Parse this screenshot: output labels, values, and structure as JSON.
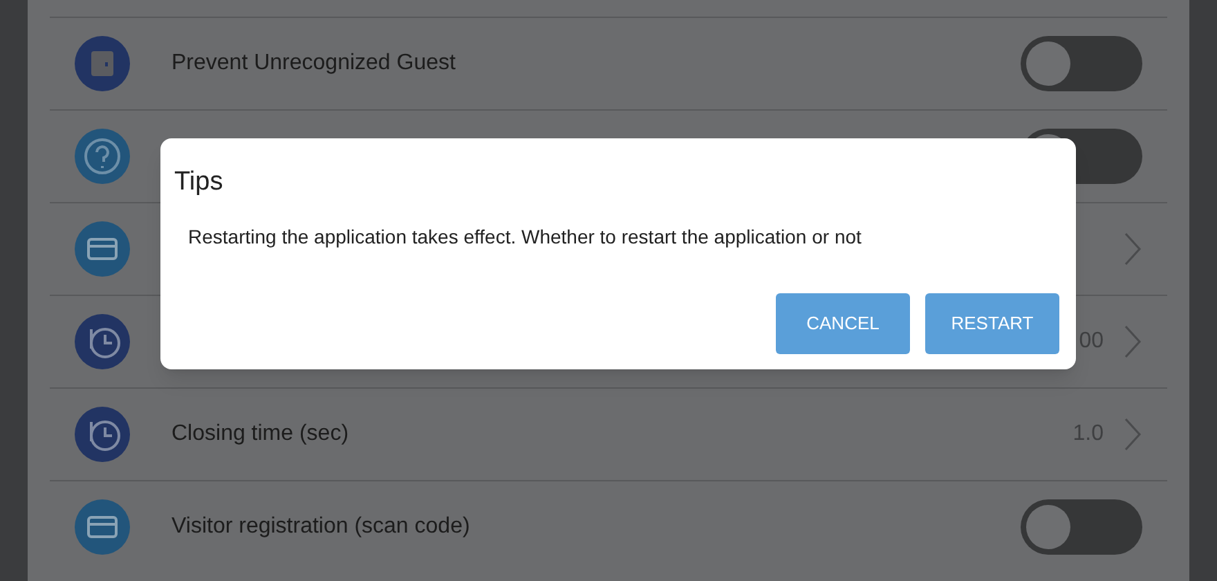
{
  "settings": [
    {
      "kind": "toggle",
      "label": "Prevent Unrecognized Guest",
      "on": false
    },
    {
      "kind": "toggle",
      "on": false
    },
    {
      "kind": "link"
    },
    {
      "kind": "link",
      "value": "00"
    },
    {
      "kind": "link",
      "label": "Closing time (sec)",
      "value": "1.0"
    },
    {
      "kind": "toggle",
      "label": "Visitor registration (scan code)",
      "on": false
    }
  ],
  "dialog": {
    "title": "Tips",
    "message": "Restarting the application takes effect. Whether to restart the application or not",
    "buttons": [
      "CANCEL",
      "RESTART"
    ]
  }
}
